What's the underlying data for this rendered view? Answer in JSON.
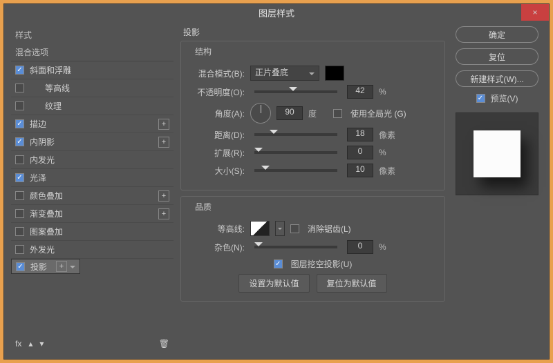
{
  "title": "图层样式",
  "close": "×",
  "left": {
    "header": "样式",
    "sub": "混合选项",
    "effects": [
      {
        "label": "斜面和浮雕",
        "checked": true,
        "plus": false
      },
      {
        "label": "等高线",
        "checked": false,
        "plus": false
      },
      {
        "label": "纹理",
        "checked": false,
        "plus": false
      },
      {
        "label": "描边",
        "checked": true,
        "plus": true
      },
      {
        "label": "内阴影",
        "checked": true,
        "plus": true
      },
      {
        "label": "内发光",
        "checked": false,
        "plus": false
      },
      {
        "label": "光泽",
        "checked": true,
        "plus": false
      },
      {
        "label": "颜色叠加",
        "checked": false,
        "plus": true
      },
      {
        "label": "渐变叠加",
        "checked": false,
        "plus": true
      },
      {
        "label": "图案叠加",
        "checked": false,
        "plus": false
      },
      {
        "label": "外发光",
        "checked": false,
        "plus": false
      },
      {
        "label": "投影",
        "checked": true,
        "plus": true,
        "selected": true
      }
    ],
    "fx": "fx"
  },
  "mid": {
    "title": "投影",
    "structure": "结构",
    "blend": "混合模式(B):",
    "blend_val": "正片叠底",
    "opacity": "不透明度(O):",
    "opacity_val": "42",
    "opacity_unit": "%",
    "angle": "角度(A):",
    "angle_val": "90",
    "angle_unit": "度",
    "global": "使用全局光 (G)",
    "dist": "距离(D):",
    "dist_val": "18",
    "dist_unit": "像素",
    "spread": "扩展(R):",
    "spread_val": "0",
    "spread_unit": "%",
    "size": "大小(S):",
    "size_val": "10",
    "size_unit": "像素",
    "quality": "品质",
    "contour": "等高线:",
    "aa": "消除锯齿(L)",
    "noise": "杂色(N):",
    "noise_val": "0",
    "noise_unit": "%",
    "knock": "图层挖空投影(U)",
    "setdef": "设置为默认值",
    "reset": "复位为默认值"
  },
  "right": {
    "ok": "确定",
    "cancel": "复位",
    "new": "新建样式(W)...",
    "preview": "预览(V)"
  }
}
